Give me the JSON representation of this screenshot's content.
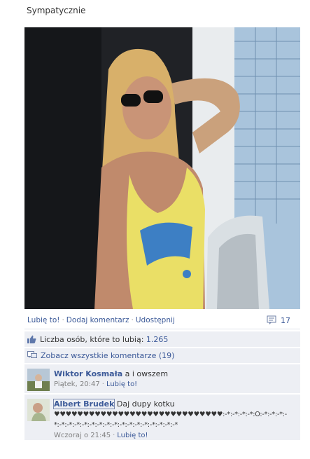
{
  "header": {
    "title": "Sympatycznie"
  },
  "actions": {
    "like_label": "Lubię to!",
    "comment_label": "Dodaj komentarz",
    "share_label": "Udostępnij",
    "comment_count": "17"
  },
  "likes": {
    "label": "Liczba osób, które to lubią:",
    "count": "1.265"
  },
  "view_all": {
    "label": "Zobacz wszystkie komentarze (19)"
  },
  "comments": [
    {
      "author": "Wiktor Kosmała",
      "text": "a i owszem",
      "time": "Piątek, 20:47",
      "like_label": "Lubię to!"
    },
    {
      "author": "Albert Brudek",
      "text": "Daj dupy kotku",
      "hearts": "♥♥♥♥♥♥♥♥♥♥♥♥♥♥♥♥♥♥♥♥♥♥♥♥♥♥♥♥♥:-*:-*:-*:-*:O:-*:-*:-*:-*:-*:-*:-*:-*:-*:-*:-*:-*:-*:-*:-*:-*:-*:-*:-*:-*",
      "time": "Wczoraj o 21:45",
      "like_label": "Lubię to!"
    }
  ],
  "icons": {
    "comment": "comment-bubble-icon",
    "like": "thumbs-up-icon",
    "view_all": "speech-bubbles-icon"
  },
  "colors": {
    "link": "#3b5998",
    "panel": "#edeff4",
    "meta": "#808080"
  }
}
